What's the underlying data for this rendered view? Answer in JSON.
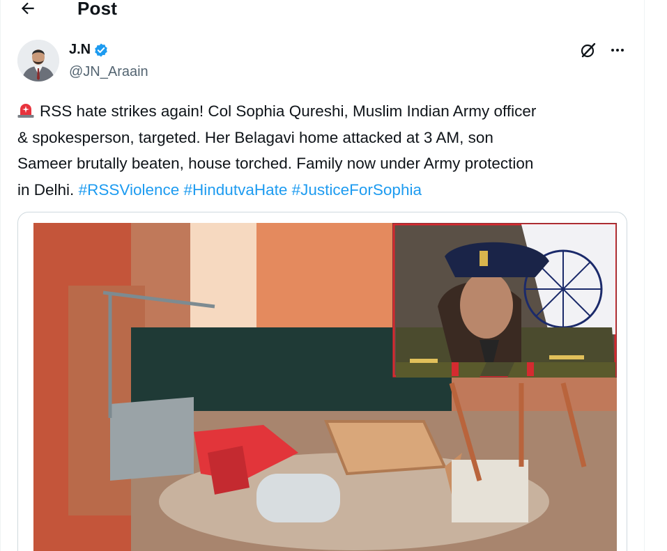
{
  "header": {
    "title": "Post",
    "back_icon": "arrow-left-icon"
  },
  "author": {
    "display_name": "J.N",
    "handle": "@JN_Araain",
    "verified": true,
    "verified_color": "#1d9bf0"
  },
  "actions": {
    "grok_icon": "grok-icon",
    "more_icon": "more-horizontal-icon"
  },
  "post": {
    "siren_icon": "rotating-light-icon",
    "line1": "RSS hate strikes again! Col Sophia Qureshi, Muslim Indian Army officer",
    "line2": "& spokesperson, targeted. Her Belagavi home attacked at 3 AM, son",
    "line3": "Sameer brutally beaten, house torched. Family now under Army protection",
    "line4_prefix": "in Delhi.",
    "hashtags": [
      "#RSSViolence",
      "#HindutvaHate",
      "#JusticeForSophia"
    ]
  },
  "colors": {
    "text": "#0f1419",
    "secondary": "#536471",
    "link": "#1d9bf0",
    "border": "#cfd9de"
  }
}
